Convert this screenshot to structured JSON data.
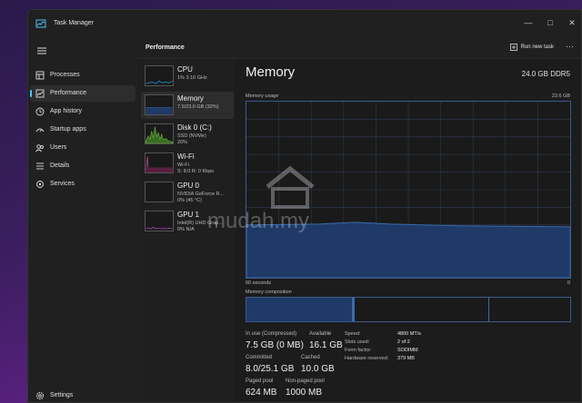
{
  "window": {
    "title": "Task Manager"
  },
  "sidebar": {
    "items": [
      {
        "label": "Processes",
        "icon": "processes-icon"
      },
      {
        "label": "Performance",
        "icon": "performance-icon",
        "active": true
      },
      {
        "label": "App history",
        "icon": "app-history-icon"
      },
      {
        "label": "Startup apps",
        "icon": "startup-icon"
      },
      {
        "label": "Users",
        "icon": "users-icon"
      },
      {
        "label": "Details",
        "icon": "details-icon"
      },
      {
        "label": "Services",
        "icon": "services-icon"
      }
    ],
    "settings_label": "Settings"
  },
  "header": {
    "title": "Performance",
    "run_task_label": "Run new task"
  },
  "perf_items": [
    {
      "name": "CPU",
      "sub1": "1% 3.16 GHz",
      "sub2": ""
    },
    {
      "name": "Memory",
      "sub1": "7.5/23.6 GB (32%)",
      "sub2": ""
    },
    {
      "name": "Disk 0 (C:)",
      "sub1": "SSD (NVMe)",
      "sub2": "20%"
    },
    {
      "name": "Wi-Fi",
      "sub1": "Wi-Fi",
      "sub2": "S: 8.0 R: 0 Kbps"
    },
    {
      "name": "GPU 0",
      "sub1": "NVIDIA GeForce R...",
      "sub2": "0% (45 °C)"
    },
    {
      "name": "GPU 1",
      "sub1": "Intel(R) UHD Grap...",
      "sub2": "0% N/A"
    }
  ],
  "detail": {
    "title": "Memory",
    "total": "24.0 GB DDR5",
    "usage_label": "Memory usage",
    "usage_max": "23.6 GB",
    "time_left": "60 seconds",
    "time_right": "0",
    "composition_label": "Memory composition",
    "memory_level": 0.32,
    "stats": {
      "in_use_label": "In use (Compressed)",
      "in_use": "7.5 GB (0 MB)",
      "available_label": "Available",
      "available": "16.1 GB",
      "committed_label": "Committed",
      "committed": "8.0/25.1 GB",
      "cached_label": "Cached",
      "cached": "10.0 GB",
      "paged_label": "Paged pool",
      "paged": "624 MB",
      "nonpaged_label": "Non-paged pool",
      "nonpaged": "1000 MB"
    },
    "kv": {
      "speed_label": "Speed:",
      "speed": "4800 MT/s",
      "slots_label": "Slots used:",
      "slots": "2 of 2",
      "form_label": "Form factor:",
      "form": "SODIMM",
      "reserved_label": "Hardware reserved:",
      "reserved": "379 MB"
    }
  },
  "watermark": "mudah.my",
  "colors": {
    "accent": "#4cc2ff",
    "memory_fill": "#1f3a66",
    "memory_line": "#3a6bb0"
  }
}
